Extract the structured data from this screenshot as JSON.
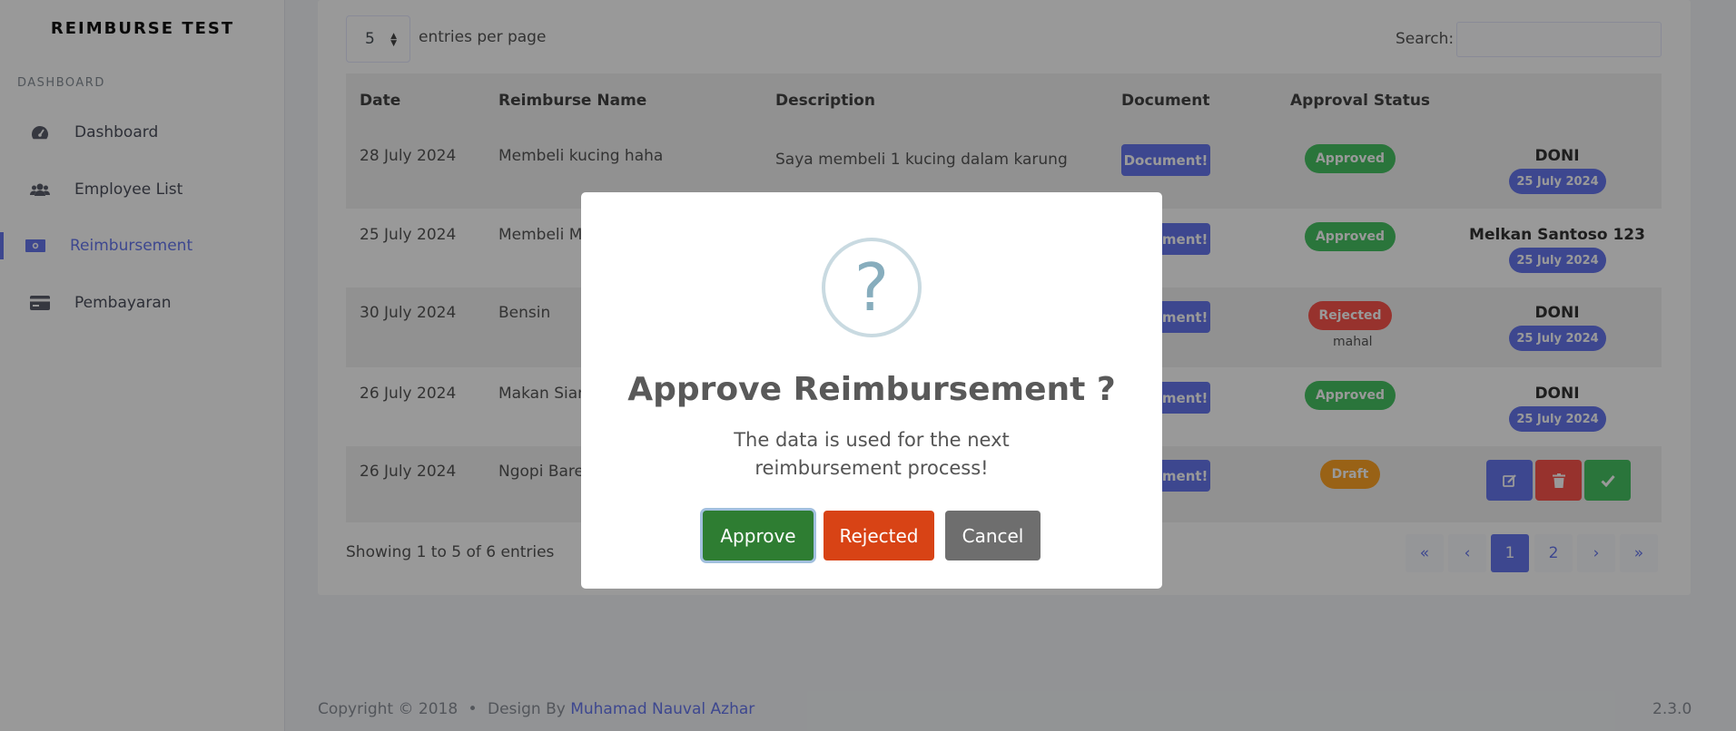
{
  "sidebar": {
    "brand": "REIMBURSE TEST",
    "heading": "DASHBOARD",
    "items": [
      {
        "label": "Dashboard",
        "icon": "gauge-icon"
      },
      {
        "label": "Employee List",
        "icon": "users-icon"
      },
      {
        "label": "Reimbursement",
        "icon": "money-bill-icon",
        "active": true
      },
      {
        "label": "Pembayaran",
        "icon": "credit-card-icon"
      }
    ]
  },
  "table_controls": {
    "page_length": "5",
    "page_length_label": "entries per page",
    "search_label": "Search:",
    "search_value": ""
  },
  "table": {
    "headers": [
      "Date",
      "Reimburse Name",
      "Description",
      "Document",
      "Approval Status"
    ],
    "document_button": "Document!",
    "document_button_visible": "ument!",
    "rows": [
      {
        "date": "28 July 2024",
        "name": "Membeli kucing haha",
        "description": "Saya membeli 1 kucing dalam karung",
        "status": "Approved",
        "note": "",
        "approver": "DONI",
        "approver_date": "25 July 2024"
      },
      {
        "date": "25 July 2024",
        "name": "Membeli Ma",
        "description": "",
        "status": "Approved",
        "note": "",
        "approver": "Melkan Santoso 123",
        "approver_date": "25 July 2024"
      },
      {
        "date": "30 July 2024",
        "name": "Bensin",
        "description": "",
        "status": "Rejected",
        "note": "mahal",
        "approver": "DONI",
        "approver_date": "25 July 2024"
      },
      {
        "date": "26 July 2024",
        "name": "Makan Sian",
        "description": "",
        "status": "Approved",
        "note": "",
        "approver": "DONI",
        "approver_date": "25 July 2024"
      },
      {
        "date": "26 July 2024",
        "name": "Ngopi Baren",
        "description": "",
        "status": "Draft",
        "note": "",
        "approver": "",
        "approver_date": ""
      }
    ]
  },
  "pagination": {
    "info": "Showing 1 to 5 of 6 entries",
    "first": "«",
    "prev": "‹",
    "pages": [
      "1",
      "2"
    ],
    "current": "1",
    "next": "›",
    "last": "»"
  },
  "footer": {
    "copyright": "Copyright © 2018",
    "separator": "•",
    "design_by": "Design By",
    "author": "Muhamad Nauval Azhar",
    "version": "2.3.0"
  },
  "modal": {
    "icon": "?",
    "title": "Approve Reimbursement ?",
    "text": "The data is used for the next reimbursement process!",
    "approve_label": "Approve",
    "reject_label": "Rejected",
    "cancel_label": "Cancel"
  },
  "colors": {
    "primary": "#6777ef",
    "success": "#47c363",
    "danger": "#fc544b",
    "warning": "#ffa426",
    "modal_approve": "#2e7d32",
    "modal_reject": "#d84315",
    "modal_cancel": "#6e6e6e"
  }
}
